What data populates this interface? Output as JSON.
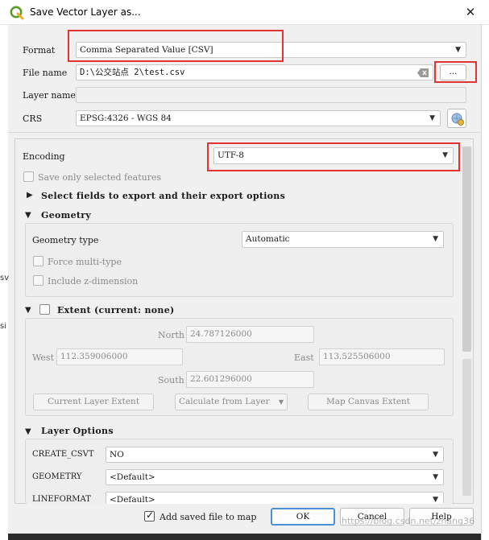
{
  "window": {
    "title": "Save Vector Layer as...",
    "close_label": "✕"
  },
  "form": {
    "format_label": "Format",
    "format_value": "Comma Separated Value [CSV]",
    "filename_label": "File name",
    "filename_value": "D:\\公交站点 2\\test.csv",
    "browse_label": "...",
    "layername_label": "Layer name",
    "layername_value": "",
    "crs_label": "CRS",
    "crs_value": "EPSG:4326 - WGS 84"
  },
  "encoding": {
    "label": "Encoding",
    "value": "UTF-8",
    "save_selected_label": "Save only selected features"
  },
  "select_fields": {
    "label": "Select fields to export and their export options"
  },
  "geometry": {
    "header": "Geometry",
    "type_label": "Geometry type",
    "type_value": "Automatic",
    "force_multi_label": "Force multi-type",
    "include_z_label": "Include z-dimension"
  },
  "extent": {
    "header": "Extent (current: none)",
    "north_label": "North",
    "north_value": "24.787126000",
    "west_label": "West",
    "west_value": "112.359006000",
    "east_label": "East",
    "east_value": "113.525506000",
    "south_label": "South",
    "south_value": "22.601296000",
    "current_layer_btn": "Current Layer Extent",
    "calc_from_layer_btn": "Calculate from Layer",
    "map_canvas_btn": "Map Canvas Extent"
  },
  "layer_options": {
    "header": "Layer Options",
    "rows": [
      {
        "name": "CREATE_CSVT",
        "value": "NO"
      },
      {
        "name": "GEOMETRY",
        "value": "<Default>"
      },
      {
        "name": "LINEFORMAT",
        "value": "<Default>"
      }
    ]
  },
  "footer": {
    "add_saved_label": "Add saved file to map",
    "ok_label": "OK",
    "cancel_label": "Cancel",
    "help_label": "Help"
  },
  "background": {
    "left_fragment_1": "sv",
    "left_fragment_2": "si"
  },
  "watermark": "https://blog.csdn.net/zhang36"
}
